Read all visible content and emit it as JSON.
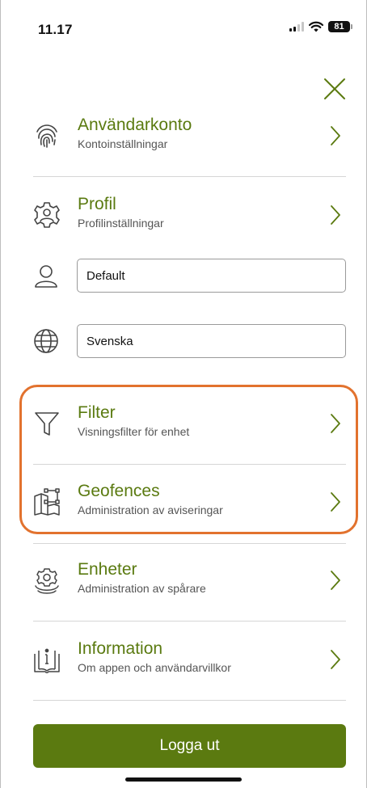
{
  "status_bar": {
    "time": "11.17",
    "battery": "81"
  },
  "menu": {
    "account": {
      "title": "Användarkonto",
      "subtitle": "Kontoinställningar"
    },
    "profile": {
      "title": "Profil",
      "subtitle": "Profilinställningar"
    },
    "filter": {
      "title": "Filter",
      "subtitle": "Visningsfilter för enhet"
    },
    "geofences": {
      "title": "Geofences",
      "subtitle": "Administration av aviseringar"
    },
    "devices": {
      "title": "Enheter",
      "subtitle": "Administration av spårare"
    },
    "information": {
      "title": "Information",
      "subtitle": "Om appen och användarvillkor"
    }
  },
  "fields": {
    "profile_select": {
      "value": "Default"
    },
    "language_select": {
      "value": "Svenska"
    }
  },
  "logout_label": "Logga ut",
  "colors": {
    "accent": "#5b7a10",
    "highlight": "#e2722e"
  },
  "icons": {
    "close": "close-icon",
    "account": "fingerprint-icon",
    "profile": "profile-gear-icon",
    "user": "user-icon",
    "language": "globe-icon",
    "filter": "funnel-icon",
    "geofences": "map-geofence-icon",
    "devices": "devices-gear-icon",
    "information": "info-book-icon",
    "chevron": "chevron-right-icon"
  }
}
